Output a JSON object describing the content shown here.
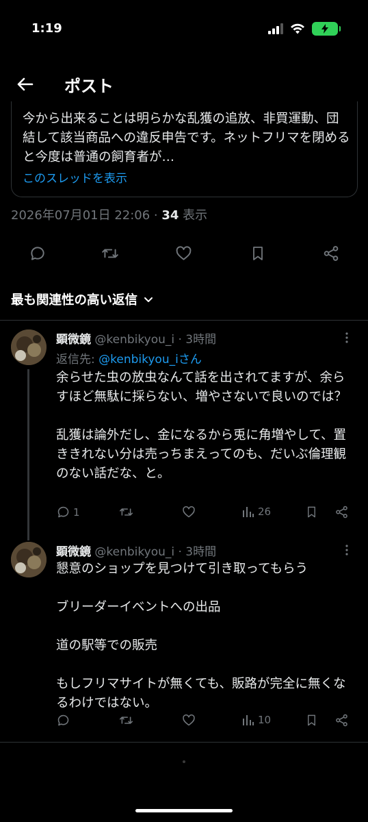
{
  "status": {
    "time": "1:19"
  },
  "header": {
    "title": "ポスト"
  },
  "quote": {
    "text": "今から出来ることは明らかな乱獲の追放、非買運動、団結して該当商品への違反申告です。ネットフリマを閉めると今度は普通の飼育者が…",
    "link": "このスレッドを表示"
  },
  "meta": {
    "datetime": "2026年07月01日 22:06 · ",
    "views": "34",
    "views_label": " 表示"
  },
  "sort": {
    "label": "最も関連性の高い返信"
  },
  "replies": [
    {
      "name": "顕微鏡",
      "handle": "@kenbikyou_i",
      "time": "· 3時間",
      "replyto_prefix": "返信先: ",
      "replyto_mention": "@kenbikyou_iさん",
      "body": "余らせた虫の放虫なんて話を出されてますが、余らすほど無駄に採らない、増やさないで良いのでは？\n\n乱獲は論外だし、金になるから兎に角増やして、置ききれない分は売っちまえってのも、だいぶ倫理観のない話だな、と。",
      "replies": "1",
      "views": "26"
    },
    {
      "name": "顕微鏡",
      "handle": "@kenbikyou_i",
      "time": "· 3時間",
      "body": "懇意のショップを見つけて引き取ってもらう\n\nブリーダーイベントへの出品\n\n道の駅等での販売\n\nもしフリマサイトが無くても、販路が完全に無くなるわけではない。",
      "views": "10"
    }
  ],
  "colors": {
    "accent": "#1d9bf0",
    "muted": "#71767b",
    "text": "#e7e9ea",
    "divider": "#2f3336"
  }
}
